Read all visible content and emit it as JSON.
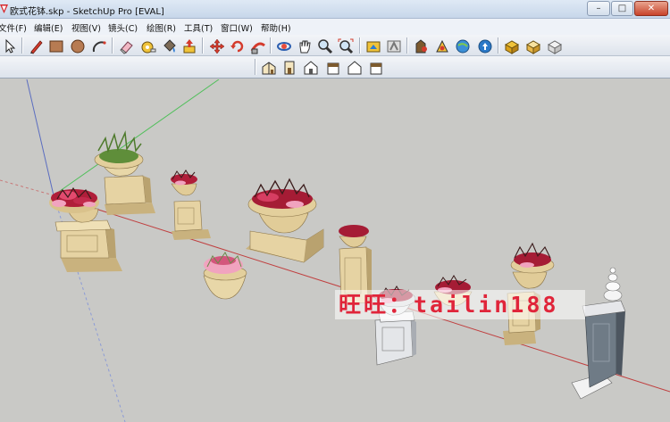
{
  "window": {
    "title": "欧式花钵.skp - SketchUp Pro [EVAL]",
    "buttons": {
      "minimize": "–",
      "maximize": "□",
      "close": "✕"
    }
  },
  "menu": {
    "items": [
      "文件(F)",
      "编辑(E)",
      "视图(V)",
      "镜头(C)",
      "绘图(R)",
      "工具(T)",
      "窗口(W)",
      "帮助(H)"
    ]
  },
  "toolbar": {
    "tools": [
      "select-icon",
      "pencil-line-icon",
      "rectangle-icon",
      "circle-icon",
      "arc-icon",
      "eraser-icon",
      "tape-measure-icon",
      "paint-bucket-icon",
      "push-pull-icon",
      "move-icon",
      "rotate-icon",
      "follow-me-icon",
      "orbit-icon",
      "pan-icon",
      "zoom-icon",
      "zoom-extents-icon",
      "previous-view-icon",
      "walk-icon",
      "position-camera-icon",
      "look-around-icon",
      "get-models-icon",
      "share-model-icon",
      "components-icon",
      "styles-icon"
    ],
    "views": [
      "iso-view-icon",
      "top-view-icon",
      "front-view-icon",
      "right-view-icon",
      "back-view-icon",
      "left-view-icon"
    ]
  },
  "viewport": {
    "watermark": "旺旺：tailin188"
  },
  "colors": {
    "viewport_bg": "#c9c9c6",
    "axis_red": "#c04040",
    "axis_green": "#4fbf5a",
    "axis_blue": "#5b6dc0",
    "stone": "#e6d3a3",
    "stone_shadow": "#a89466",
    "watermark": "#e0253a"
  }
}
